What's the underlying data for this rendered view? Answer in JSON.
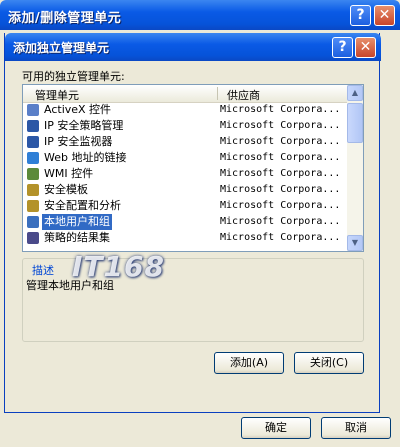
{
  "outer_window": {
    "title": "添加/删除管理单元",
    "help_btn": "?",
    "close_btn": "✕",
    "ok_label": "确定",
    "cancel_label": "取消"
  },
  "dialog": {
    "title": "添加独立管理单元",
    "help_btn": "?",
    "close_btn": "✕",
    "list_label": "可用的独立管理单元:",
    "columns": {
      "name": "管理单元",
      "vendor": "供应商"
    },
    "rows": [
      {
        "name": "ActiveX 控件",
        "vendor": "Microsoft Corpora...",
        "icon": "activex-icon",
        "color": "#5a7fc8"
      },
      {
        "name": "IP 安全策略管理",
        "vendor": "Microsoft Corpora...",
        "icon": "ip-policy-icon",
        "color": "#2b57a6"
      },
      {
        "name": "IP 安全监视器",
        "vendor": "Microsoft Corpora...",
        "icon": "ip-monitor-icon",
        "color": "#2b57a6"
      },
      {
        "name": "Web 地址的链接",
        "vendor": "Microsoft Corpora...",
        "icon": "web-link-icon",
        "color": "#2f7fd6"
      },
      {
        "name": "WMI 控件",
        "vendor": "Microsoft Corpora...",
        "icon": "wmi-icon",
        "color": "#5b8a3a"
      },
      {
        "name": "安全模板",
        "vendor": "Microsoft Corpora...",
        "icon": "security-template-icon",
        "color": "#b3922a"
      },
      {
        "name": "安全配置和分析",
        "vendor": "Microsoft Corpora...",
        "icon": "security-config-icon",
        "color": "#b3922a"
      },
      {
        "name": "本地用户和组",
        "vendor": "Microsoft Corpora...",
        "icon": "users-icon",
        "color": "#3a6fbe",
        "selected": true
      },
      {
        "name": "策略的结果集",
        "vendor": "Microsoft Corpora...",
        "icon": "rsop-icon",
        "color": "#4a4a8a"
      }
    ],
    "description_legend": "描述",
    "description_text": "管理本地用户和组",
    "add_label": "添加(A)",
    "close_label": "关闭(C)"
  },
  "watermark": "IT168"
}
